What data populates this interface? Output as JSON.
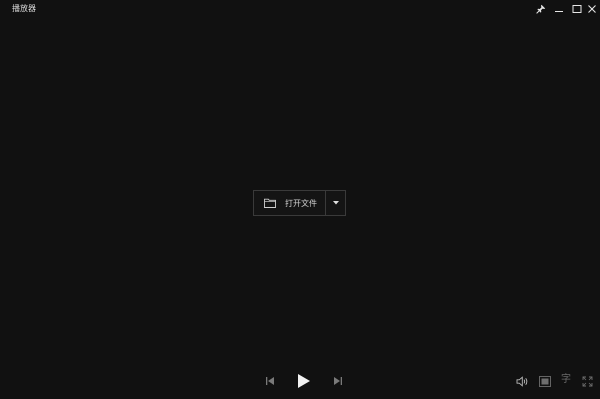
{
  "window": {
    "title": "播放器",
    "pin_icon": "pin-icon",
    "minimize_icon": "minimize-icon",
    "maximize_icon": "maximize-icon",
    "close_icon": "close-icon"
  },
  "center": {
    "open_file_label": "打开文件",
    "folder_icon": "folder-icon",
    "dropdown_icon": "triangle-down-icon"
  },
  "controls": {
    "previous_icon": "skip-previous-icon",
    "play_icon": "play-icon",
    "next_icon": "skip-next-icon",
    "volume_icon": "speaker-icon",
    "pip_icon": "picture-in-picture-icon",
    "subtitle_label": "字",
    "fullscreen_icon": "fullscreen-icon"
  },
  "colors": {
    "background": "#111111",
    "text": "#d8d8d8",
    "border": "#3a3a3a",
    "icon_dim": "#6a6a6a"
  }
}
